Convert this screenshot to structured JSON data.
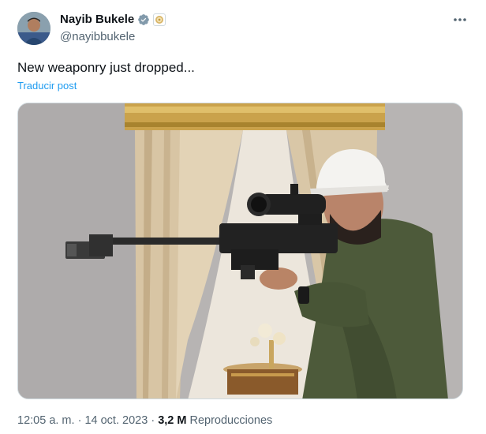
{
  "author": {
    "display_name": "Nayib Bukele",
    "handle": "@nayibbukele",
    "verified_badge": "verified-check-icon",
    "affiliation_badge": "government-affiliation-icon"
  },
  "post": {
    "text": "New weaponry just dropped...",
    "translate_label": "Traducir post",
    "media_alt_icon": "photo-media"
  },
  "meta": {
    "time": "12:05 a. m.",
    "separator": "·",
    "date": "14 oct. 2023",
    "views_count": "3,2 M",
    "views_label": "Reproducciones"
  },
  "colors": {
    "accent": "#1d9bf0",
    "secondary_text": "#536471",
    "primary_text": "#0f1419"
  }
}
